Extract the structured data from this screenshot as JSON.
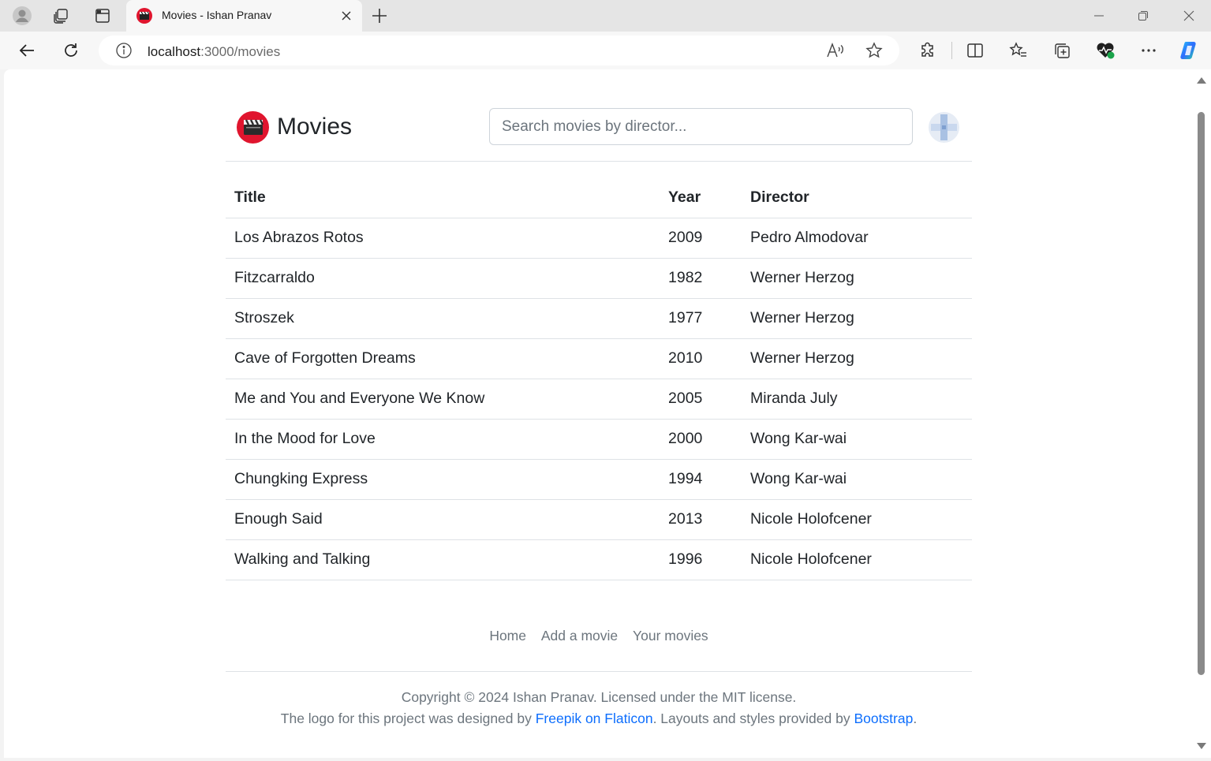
{
  "browser": {
    "tab_title": "Movies - Ishan Pranav",
    "url_host": "localhost",
    "url_path": ":3000/movies"
  },
  "header": {
    "brand": "Movies",
    "search_placeholder": "Search movies by director..."
  },
  "table": {
    "headers": [
      "Title",
      "Year",
      "Director"
    ],
    "rows": [
      [
        "Los Abrazos Rotos",
        "2009",
        "Pedro Almodovar"
      ],
      [
        "Fitzcarraldo",
        "1982",
        "Werner Herzog"
      ],
      [
        "Stroszek",
        "1977",
        "Werner Herzog"
      ],
      [
        "Cave of Forgotten Dreams",
        "2010",
        "Werner Herzog"
      ],
      [
        "Me and You and Everyone We Know",
        "2005",
        "Miranda July"
      ],
      [
        "In the Mood for Love",
        "2000",
        "Wong Kar-wai"
      ],
      [
        "Chungking Express",
        "1994",
        "Wong Kar-wai"
      ],
      [
        "Enough Said",
        "2013",
        "Nicole Holofcener"
      ],
      [
        "Walking and Talking",
        "1996",
        "Nicole Holofcener"
      ]
    ]
  },
  "footer": {
    "nav": [
      "Home",
      "Add a movie",
      "Your movies"
    ],
    "copyright": "Copyright © 2024 Ishan Pranav. Licensed under the MIT license.",
    "credit_prefix": "The logo for this project was designed by ",
    "credit_link1": "Freepik on Flaticon",
    "credit_middle": ". Layouts and styles provided by ",
    "credit_link2": "Bootstrap",
    "credit_suffix": "."
  },
  "colors": {
    "accent_red": "#e0152e",
    "link_blue": "#0d6efd",
    "muted_text": "#6c757d"
  }
}
